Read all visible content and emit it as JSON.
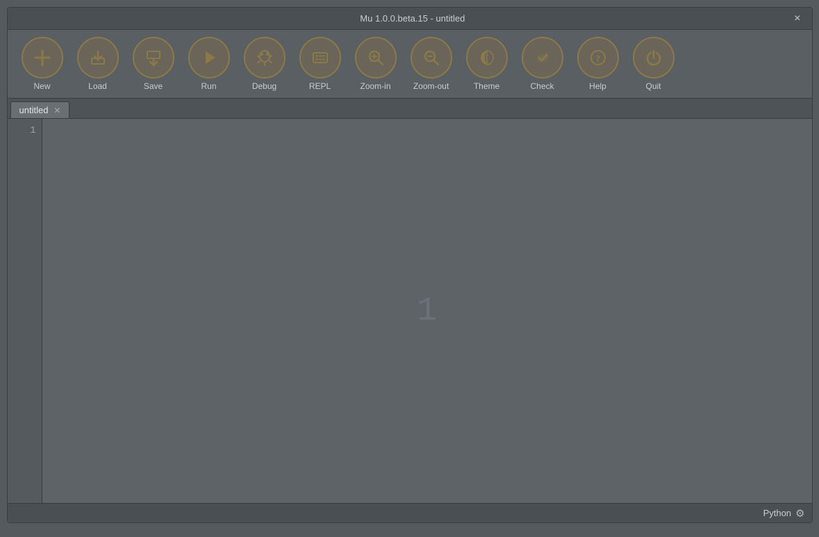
{
  "window": {
    "title": "Mu 1.0.0.beta.15 - untitled",
    "close_label": "×"
  },
  "toolbar": {
    "buttons": [
      {
        "id": "new",
        "label": "New",
        "icon": "➕"
      },
      {
        "id": "load",
        "label": "Load",
        "icon": "⬆"
      },
      {
        "id": "save",
        "label": "Save",
        "icon": "⬇"
      },
      {
        "id": "run",
        "label": "Run",
        "icon": "▶"
      },
      {
        "id": "debug",
        "label": "Debug",
        "icon": "🐞"
      },
      {
        "id": "repl",
        "label": "REPL",
        "icon": "⌨"
      },
      {
        "id": "zoom_in",
        "label": "Zoom-in",
        "icon": "🔍"
      },
      {
        "id": "zoom_out",
        "label": "Zoom-out",
        "icon": "🔍"
      },
      {
        "id": "theme",
        "label": "Theme",
        "icon": "🌙"
      },
      {
        "id": "check",
        "label": "Check",
        "icon": "👍"
      },
      {
        "id": "help",
        "label": "Help",
        "icon": "❓"
      },
      {
        "id": "quit",
        "label": "Quit",
        "icon": "⏻"
      }
    ]
  },
  "tabs": [
    {
      "label": "untitled",
      "active": true
    }
  ],
  "editor": {
    "line_numbers": [
      "1"
    ],
    "large_line_num": "1",
    "content": ""
  },
  "status_bar": {
    "language": "Python"
  }
}
